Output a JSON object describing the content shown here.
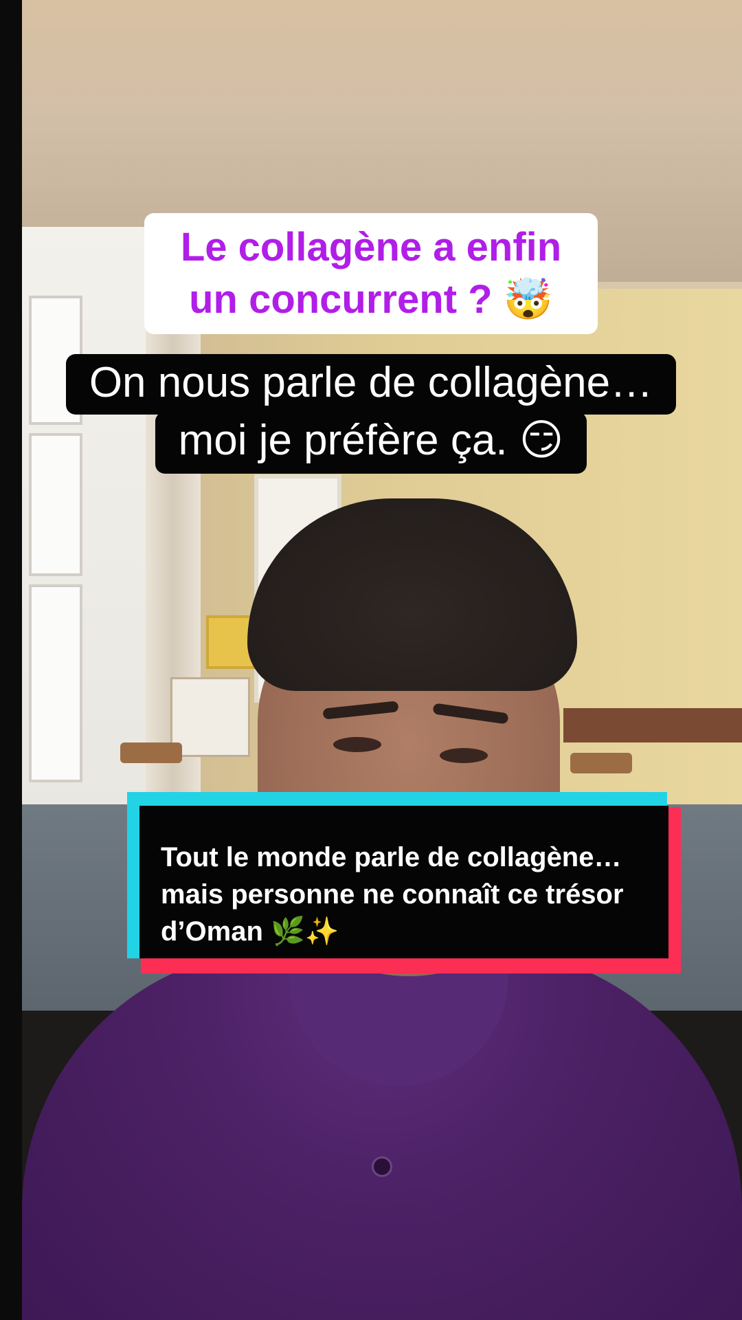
{
  "overlay": {
    "title_line1": "Le collagène a enfin",
    "title_line2": "un concurrent ? 🤯",
    "subtitle_line1": "On nous parle de collagène…",
    "subtitle_line2": "moi je préfère ça. 😏"
  },
  "caption": {
    "line1": "Tout le monde parle de collagène…",
    "line2": "mais personne ne connaît ce trésor",
    "line3": "d’Oman 🌿✨"
  },
  "colors": {
    "title_text": "#b01ee8",
    "caption_cyan": "#22d3e6",
    "caption_red": "#fd2e54",
    "shirt": "#4c2165"
  }
}
